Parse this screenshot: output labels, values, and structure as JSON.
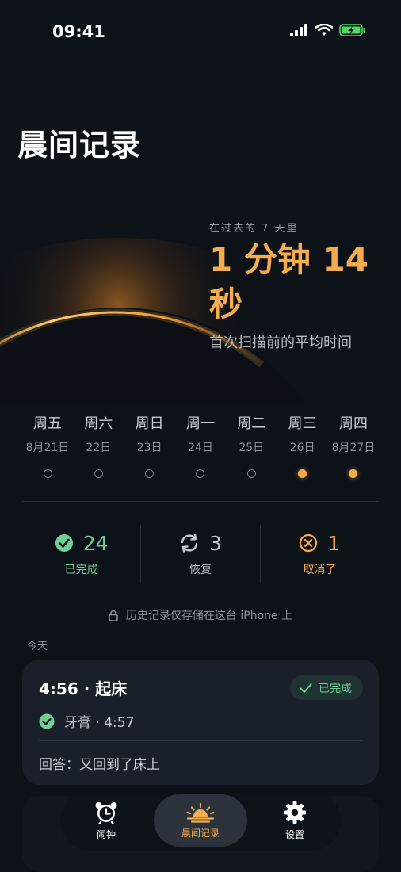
{
  "status_bar": {
    "time": "09:41"
  },
  "header": {
    "title": "晨间记录"
  },
  "summary": {
    "caption": "在过去的 7 天里",
    "value": "1 分钟 14 秒",
    "subtitle": "首次扫描前的平均时间"
  },
  "week": [
    {
      "name": "周五",
      "date": "8月21日",
      "active": false
    },
    {
      "name": "周六",
      "date": "22日",
      "active": false
    },
    {
      "name": "周日",
      "date": "23日",
      "active": false
    },
    {
      "name": "周一",
      "date": "24日",
      "active": false
    },
    {
      "name": "周二",
      "date": "25日",
      "active": false
    },
    {
      "name": "周三",
      "date": "26日",
      "active": true
    },
    {
      "name": "周四",
      "date": "8月27日",
      "active": true
    }
  ],
  "stats": {
    "completed": {
      "count": "24",
      "label": "已完成",
      "icon": "check-circle-icon",
      "color": "#6fcf97"
    },
    "restored": {
      "count": "3",
      "label": "恢复",
      "icon": "sync-icon",
      "color": "#c4c7cc"
    },
    "cancelled": {
      "count": "1",
      "label": "取消了",
      "icon": "x-circle-icon",
      "color": "#f5ac4c"
    }
  },
  "privacy": {
    "text": "历史记录仅存储在这台 iPhone 上",
    "icon": "lock-icon"
  },
  "section": {
    "today_label": "今天"
  },
  "record": {
    "title": "4:56 · 起床",
    "status": "已完成",
    "task": "牙膏 · 4:57",
    "answer": "回答：又回到了床上"
  },
  "tabs": [
    {
      "label": "闹钟",
      "icon": "alarm-clock-icon",
      "active": false
    },
    {
      "label": "晨间记录",
      "icon": "sunrise-icon",
      "active": true
    },
    {
      "label": "设置",
      "icon": "gear-icon",
      "active": false
    }
  ],
  "colors": {
    "accent": "#f5ac4c",
    "success": "#6fcf97",
    "background": "#0d1218",
    "card": "#1a2029"
  }
}
